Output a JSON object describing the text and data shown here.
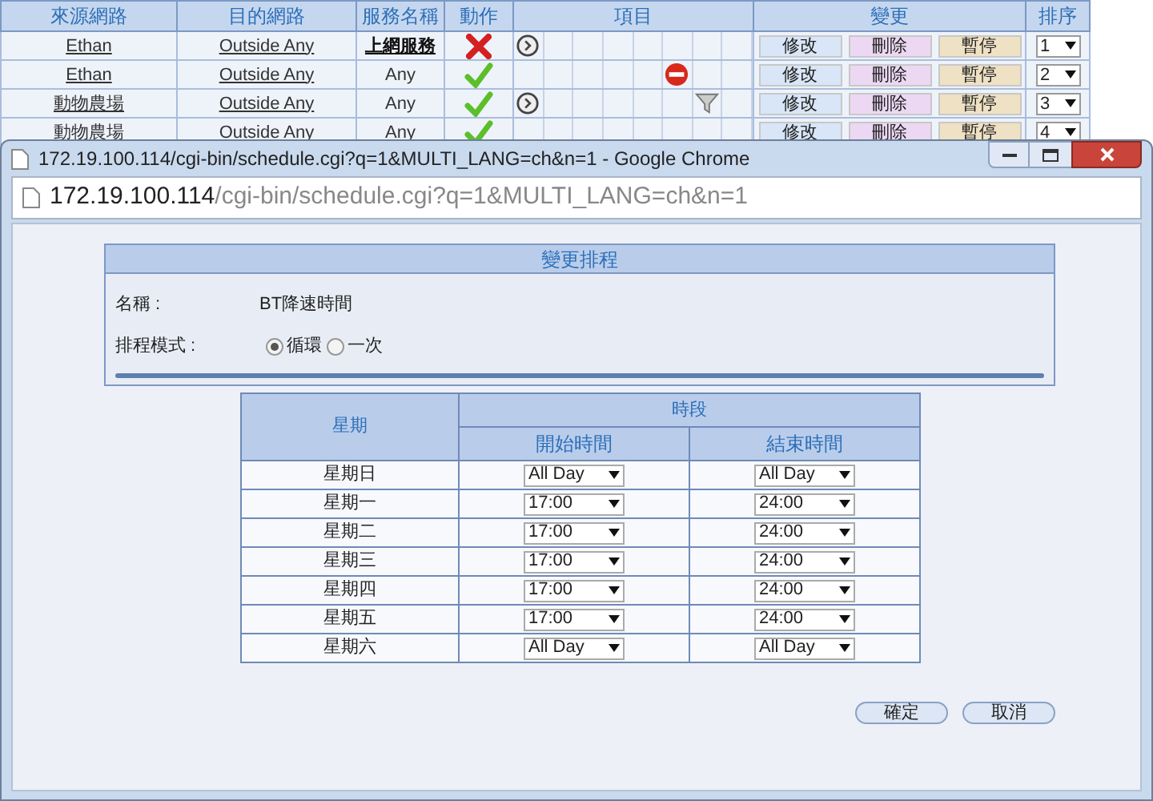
{
  "background_table": {
    "columns": [
      "來源網路",
      "目的網路",
      "服務名稱",
      "動作",
      "項目",
      "變更",
      "排序"
    ],
    "rows": [
      {
        "source": "Ethan",
        "destination": "Outside Any",
        "service": "上網服務",
        "service_link": true,
        "action": {
          "kind": "deny"
        },
        "items": [
          {
            "kind": "schedule"
          },
          {
            "kind": "empty"
          },
          {
            "kind": "empty"
          },
          {
            "kind": "empty"
          },
          {
            "kind": "empty"
          },
          {
            "kind": "empty"
          },
          {
            "kind": "empty"
          },
          {
            "kind": "empty"
          }
        ],
        "buttons": [
          "修改",
          "刪除",
          "暫停"
        ],
        "order": "1"
      },
      {
        "source": "Ethan",
        "destination": "Outside Any",
        "service": "Any",
        "service_link": false,
        "action": {
          "kind": "allow"
        },
        "items": [
          {
            "kind": "empty"
          },
          {
            "kind": "empty"
          },
          {
            "kind": "empty"
          },
          {
            "kind": "empty"
          },
          {
            "kind": "empty"
          },
          {
            "kind": "block"
          },
          {
            "kind": "empty"
          },
          {
            "kind": "empty"
          }
        ],
        "buttons": [
          "修改",
          "刪除",
          "暫停"
        ],
        "order": "2"
      },
      {
        "source": "動物農場",
        "destination": "Outside Any",
        "service": "Any",
        "service_link": false,
        "action": {
          "kind": "allow"
        },
        "items": [
          {
            "kind": "schedule"
          },
          {
            "kind": "empty"
          },
          {
            "kind": "empty"
          },
          {
            "kind": "empty"
          },
          {
            "kind": "empty"
          },
          {
            "kind": "empty"
          },
          {
            "kind": "filter"
          },
          {
            "kind": "empty"
          }
        ],
        "buttons": [
          "修改",
          "刪除",
          "暫停"
        ],
        "order": "3"
      },
      {
        "source": "動物農場",
        "destination": "Outside Any",
        "service": "Any",
        "service_link": false,
        "action": {
          "kind": "allow"
        },
        "items": [
          {
            "kind": "empty"
          },
          {
            "kind": "empty"
          },
          {
            "kind": "empty"
          },
          {
            "kind": "empty"
          },
          {
            "kind": "empty"
          },
          {
            "kind": "empty"
          },
          {
            "kind": "empty"
          },
          {
            "kind": "empty"
          }
        ],
        "buttons": [
          "修改",
          "刪除",
          "暫停"
        ],
        "order": "4"
      }
    ]
  },
  "popup": {
    "title": "172.19.100.114/cgi-bin/schedule.cgi?q=1&MULTI_LANG=ch&n=1 - Google Chrome",
    "address": {
      "host": "172.19.100.114",
      "path": "/cgi-bin/schedule.cgi?q=1&MULTI_LANG=ch&n=1"
    },
    "panel": {
      "title": "變更排程",
      "name_label": "名稱 :",
      "name_value": "BT降速時間",
      "mode_label": "排程模式 :",
      "modes": [
        {
          "label": "循環",
          "selected": true
        },
        {
          "label": "一次",
          "selected": false
        }
      ]
    },
    "schedule": {
      "day_header": "星期",
      "period_header": "時段",
      "start_header": "開始時間",
      "end_header": "結束時間",
      "rows": [
        {
          "day": "星期日",
          "start": "All Day",
          "end": "All Day"
        },
        {
          "day": "星期一",
          "start": "17:00",
          "end": "24:00"
        },
        {
          "day": "星期二",
          "start": "17:00",
          "end": "24:00"
        },
        {
          "day": "星期三",
          "start": "17:00",
          "end": "24:00"
        },
        {
          "day": "星期四",
          "start": "17:00",
          "end": "24:00"
        },
        {
          "day": "星期五",
          "start": "17:00",
          "end": "24:00"
        },
        {
          "day": "星期六",
          "start": "All Day",
          "end": "All Day"
        }
      ]
    },
    "buttons": [
      "確定",
      "取消"
    ]
  }
}
